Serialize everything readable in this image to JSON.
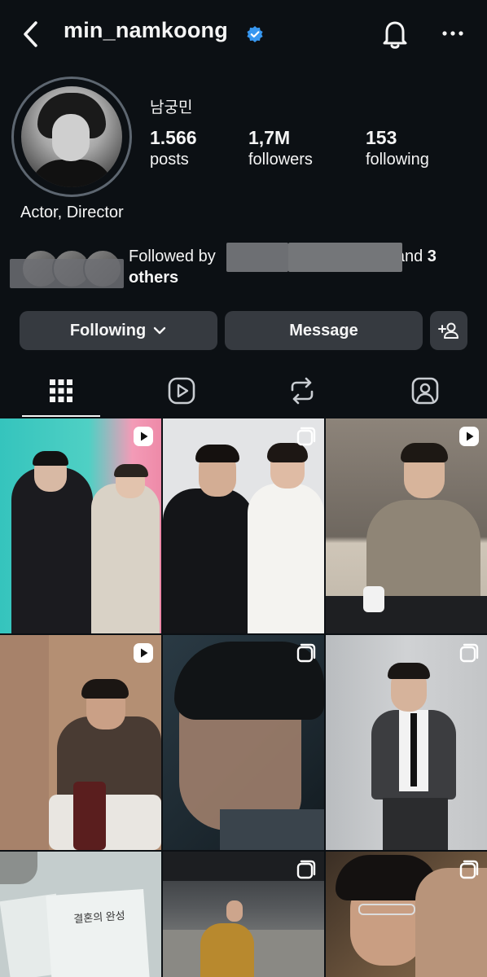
{
  "header": {
    "username": "min_namkoong",
    "back_icon": "chevron-left-icon",
    "verified_icon": "verified-badge-icon",
    "notification_icon": "bell-icon",
    "more_icon": "more-horizontal-icon"
  },
  "profile": {
    "display_name": "남궁민",
    "bio": "Actor, Director",
    "stats": [
      {
        "value": "1.566",
        "label": "posts"
      },
      {
        "value": "1,7M",
        "label": "followers"
      },
      {
        "value": "153",
        "label": "following"
      }
    ],
    "followed_by_prefix": "Followed by",
    "followed_by_suffix": "and",
    "followed_by_others": "3 others"
  },
  "actions": {
    "following_label": "Following",
    "message_label": "Message",
    "add_user_icon": "add-person-icon"
  },
  "tabs": [
    {
      "name": "posts-grid",
      "icon": "grid-icon",
      "active": true
    },
    {
      "name": "reels",
      "icon": "reels-icon",
      "active": false
    },
    {
      "name": "reposts",
      "icon": "repost-icon",
      "active": false
    },
    {
      "name": "tagged",
      "icon": "tagged-icon",
      "active": false
    }
  ],
  "posts": [
    {
      "type": "reel"
    },
    {
      "type": "carousel"
    },
    {
      "type": "reel"
    },
    {
      "type": "reel"
    },
    {
      "type": "carousel"
    },
    {
      "type": "carousel"
    },
    {
      "type": "photo",
      "caption": "결혼의 완성"
    },
    {
      "type": "carousel"
    },
    {
      "type": "carousel"
    }
  ],
  "colors": {
    "background": "#0c1014",
    "button": "#363a40",
    "verified": "#3797f0"
  }
}
